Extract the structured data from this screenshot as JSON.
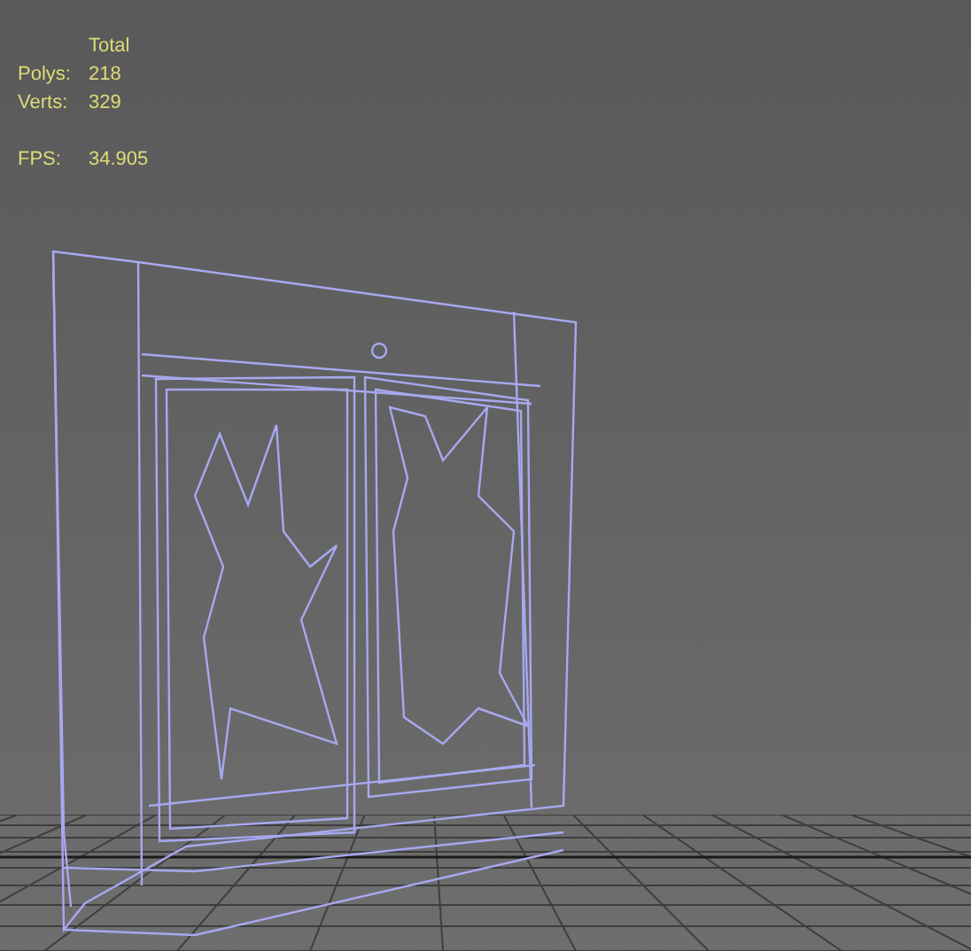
{
  "stats": {
    "header": "Total",
    "rows": [
      {
        "label": "Polys:",
        "value": "218"
      },
      {
        "label": "Verts:",
        "value": "329"
      }
    ],
    "fps": {
      "label": "FPS:",
      "value": "34.905"
    }
  }
}
